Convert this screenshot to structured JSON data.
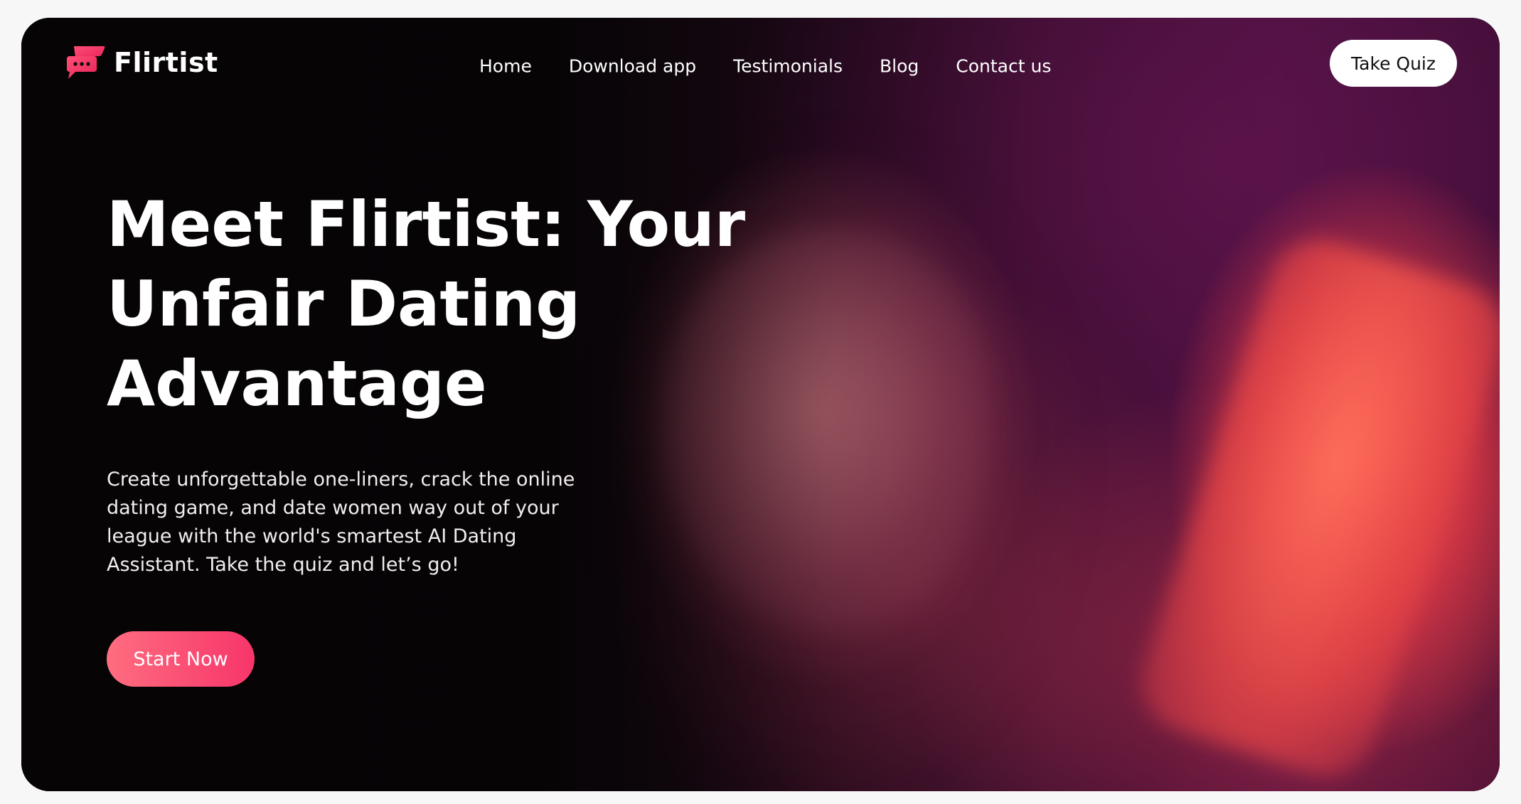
{
  "brand": {
    "name": "Flirtist",
    "logo_icon": "chat-bubble-icon",
    "accent_color": "#f7356a"
  },
  "nav": {
    "links": [
      "Home",
      "Download app",
      "Testimonials",
      "Blog",
      "Contact us"
    ],
    "cta_label": "Take Quiz"
  },
  "hero": {
    "title": "Meet Flirtist: Your Unfair Dating Advantage",
    "description": "Create unforgettable one-liners, crack the online dating game, and date women way out of your league with the world's smartest AI Dating Assistant. Take the quiz and let’s go!",
    "button_label": "Start Now",
    "button_gradient": [
      "#ff6d80",
      "#f7356a"
    ]
  }
}
